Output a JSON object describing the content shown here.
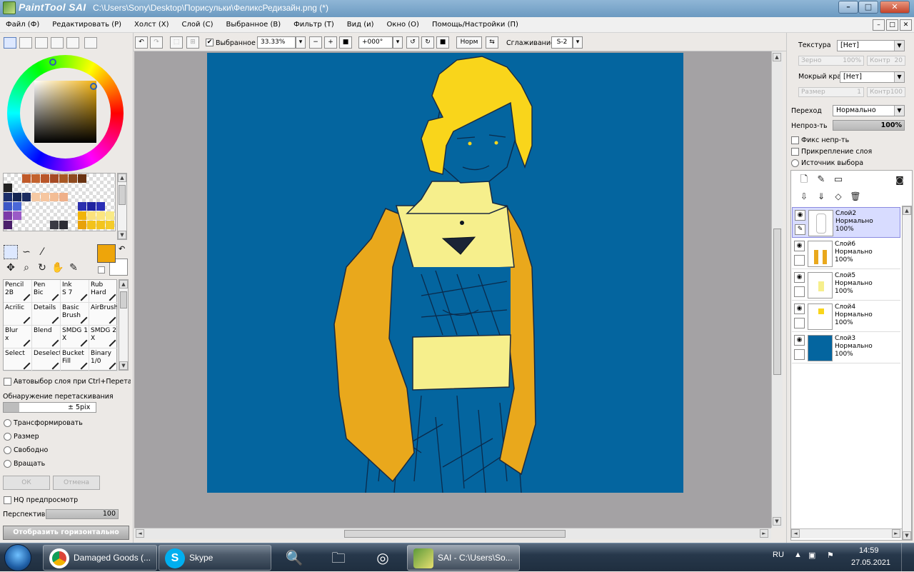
{
  "window": {
    "app_brand": "PaintTool SAI",
    "title": "C:\\Users\\Sony\\Desktop\\Порисульки\\ФеликсРедизайн.png (*)",
    "controls": {
      "minimize": "–",
      "maximize": "□",
      "close": "✕"
    }
  },
  "menu": {
    "items": [
      "Файл (Ф)",
      "Редактировать (Р)",
      "Холст (Х)",
      "Слой (С)",
      "Выбранное (В)",
      "Фильтр (Т)",
      "Вид (и)",
      "Окно (О)",
      "Помощь/Настройки (П)"
    ]
  },
  "toolbar": {
    "selection_checkbox_label": "Выбранное",
    "zoom": "33.33%",
    "rotation": "+000°",
    "blend_button": "Норм",
    "smoothing_label": "Сглаживание",
    "smoothing_value": "S-2"
  },
  "colors": {
    "primary": "#eea50a",
    "secondary": "#ffffff",
    "canvas_bg": "#04659f",
    "hair": "#f9d51b",
    "jacket": "#e9a81c",
    "shirt_light": "#f6ef8c"
  },
  "tools": {
    "brushes": [
      {
        "name": "Pencil",
        "size": "2B"
      },
      {
        "name": "Pen",
        "size": "Bic"
      },
      {
        "name": "Ink",
        "size": "S 7"
      },
      {
        "name": "Rub",
        "size": "Hard"
      },
      {
        "name": "Acrilic",
        "size": ""
      },
      {
        "name": "Details",
        "size": ""
      },
      {
        "name": "Basic",
        "size": "Brush"
      },
      {
        "name": "AirBrush",
        "size": ""
      },
      {
        "name": "Blur",
        "size": "x"
      },
      {
        "name": "Blend",
        "size": ""
      },
      {
        "name": "SMDG 1",
        "size": "X"
      },
      {
        "name": "SMDG 2",
        "size": "X"
      },
      {
        "name": "Select",
        "size": ""
      },
      {
        "name": "Deselect",
        "size": ""
      },
      {
        "name": "Bucket",
        "size": "Fill"
      },
      {
        "name": "Binary",
        "size": "1/0"
      }
    ],
    "auto_select_label": "Автовыбор слоя при Ctrl+Перетаскив",
    "drag_detect_label": "Обнаружение перетаскивания",
    "drag_detect_value": "± 5pix",
    "transform_options": [
      "Трансформировать",
      "Размер",
      "Свободно",
      "Вращать"
    ],
    "ok_button": "ОК",
    "cancel_button": "Отмена",
    "hq_preview_label": "HQ предпросмотр",
    "perspective_label": "Перспектива",
    "perspective_value": "100",
    "flip_button": "Отобразить горизонтально"
  },
  "properties": {
    "texture_label": "Текстура",
    "texture_value": "[Нет]",
    "grain_label": "Зерно",
    "grain_value": "100%",
    "contrast_label": "Контр",
    "contrast_value": "20",
    "wet_edge_label": "Мокрый край",
    "wet_edge_value": "[Нет]",
    "size_label": "Размер",
    "size_value": "1",
    "contrast2_label": "Контр",
    "contrast2_value": "100",
    "blend_label": "Переход",
    "blend_value": "Нормально",
    "opacity_label": "Непроз-ть",
    "opacity_value": "100%",
    "opacity_fraction": 1.0,
    "checkboxes": [
      "Фикс непр-ть",
      "Прикрепление слоя"
    ],
    "radio": "Источник выбора"
  },
  "layers": [
    {
      "name": "Слой2",
      "mode": "Нормально",
      "opacity": "100%",
      "selected": true
    },
    {
      "name": "Слой6",
      "mode": "Нормально",
      "opacity": "100%",
      "selected": false
    },
    {
      "name": "Слой5",
      "mode": "Нормально",
      "opacity": "100%",
      "selected": false
    },
    {
      "name": "Слой4",
      "mode": "Нормально",
      "opacity": "100%",
      "selected": false
    },
    {
      "name": "Слой3",
      "mode": "Нормально",
      "opacity": "100%",
      "selected": false
    }
  ],
  "taskbar": {
    "tasks": [
      {
        "label": "Damaged Goods (...",
        "icon": "chrome-icon"
      },
      {
        "label": "Skype",
        "icon": "skype-icon"
      },
      {
        "label": "SAI - C:\\Users\\So...",
        "icon": "sai-icon"
      }
    ],
    "language": "RU",
    "time": "14:59",
    "date": "27.05.2021"
  }
}
